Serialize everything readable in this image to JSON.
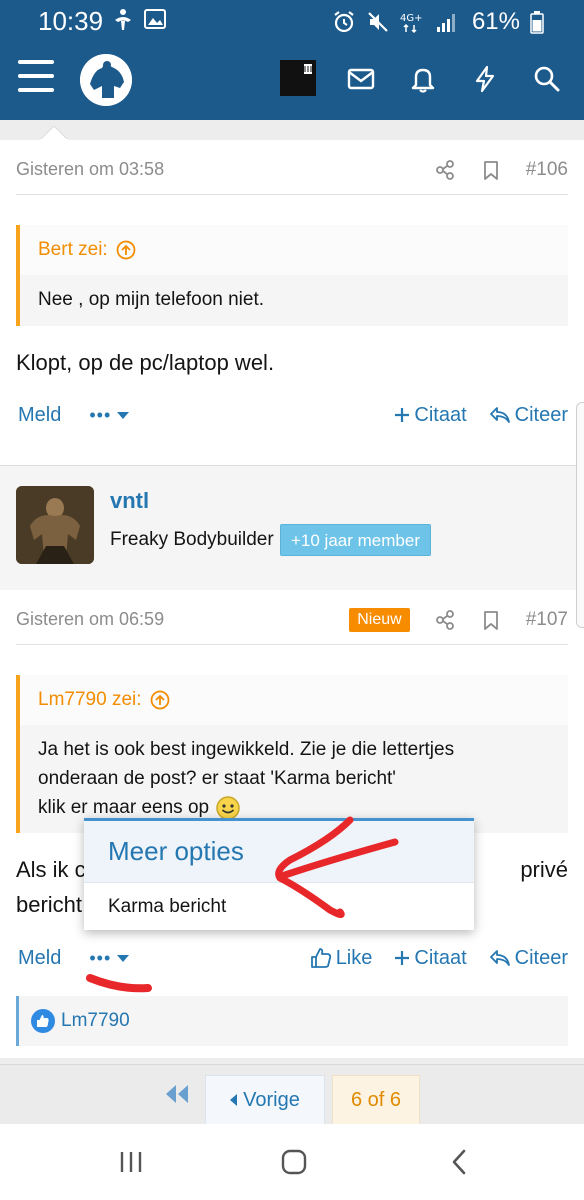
{
  "status_bar": {
    "time": "10:39",
    "network": "4G+",
    "battery": "61%"
  },
  "nav": {
    "icons": [
      "menu-icon",
      "site-logo",
      "user-avatar",
      "envelope-icon",
      "bell-icon",
      "bolt-icon",
      "search-icon"
    ]
  },
  "post106": {
    "date": "Gisteren om 03:58",
    "number": "#106",
    "quote_author": "Bert zei:",
    "quote_text": "Nee , op mijn telefoon niet.",
    "body": "Klopt, op de pc/laptop wel.",
    "actions": {
      "report": "Meld",
      "more": "•••",
      "multiquote": "Citaat",
      "reply": "Citeer"
    }
  },
  "user": {
    "name": "vntl",
    "title": "Freaky Bodybuilder",
    "banner": "+10 jaar member"
  },
  "post107": {
    "date": "Gisteren om 06:59",
    "new_badge": "Nieuw",
    "number": "#107",
    "quote_author": "Lm7790 zei:",
    "quote_line1": "Ja het is ook best ingewikkeld. Zie je die lettertjes",
    "quote_line2": "onderaan de post? er staat 'Karma bericht'",
    "quote_line3": "klik er maar eens op",
    "body_line1_start": "Als ik c",
    "body_line1_end": "privé",
    "body_line2_start": "bericht",
    "actions": {
      "report": "Meld",
      "more": "•••",
      "like": "Like",
      "multiquote": "Citaat",
      "reply": "Citeer"
    },
    "liked_by": "Lm7790"
  },
  "popup": {
    "title": "Meer opties",
    "items": [
      "Karma bericht"
    ]
  },
  "pagination": {
    "prev": "Vorige",
    "current": "6 of 6"
  },
  "colors": {
    "header": "#1d5a8c",
    "link": "#2577b1",
    "quote_accent": "#f9a21b",
    "new_badge": "#f78c00",
    "member_banner": "#6ec3e8",
    "annotation": "#e8272a"
  }
}
